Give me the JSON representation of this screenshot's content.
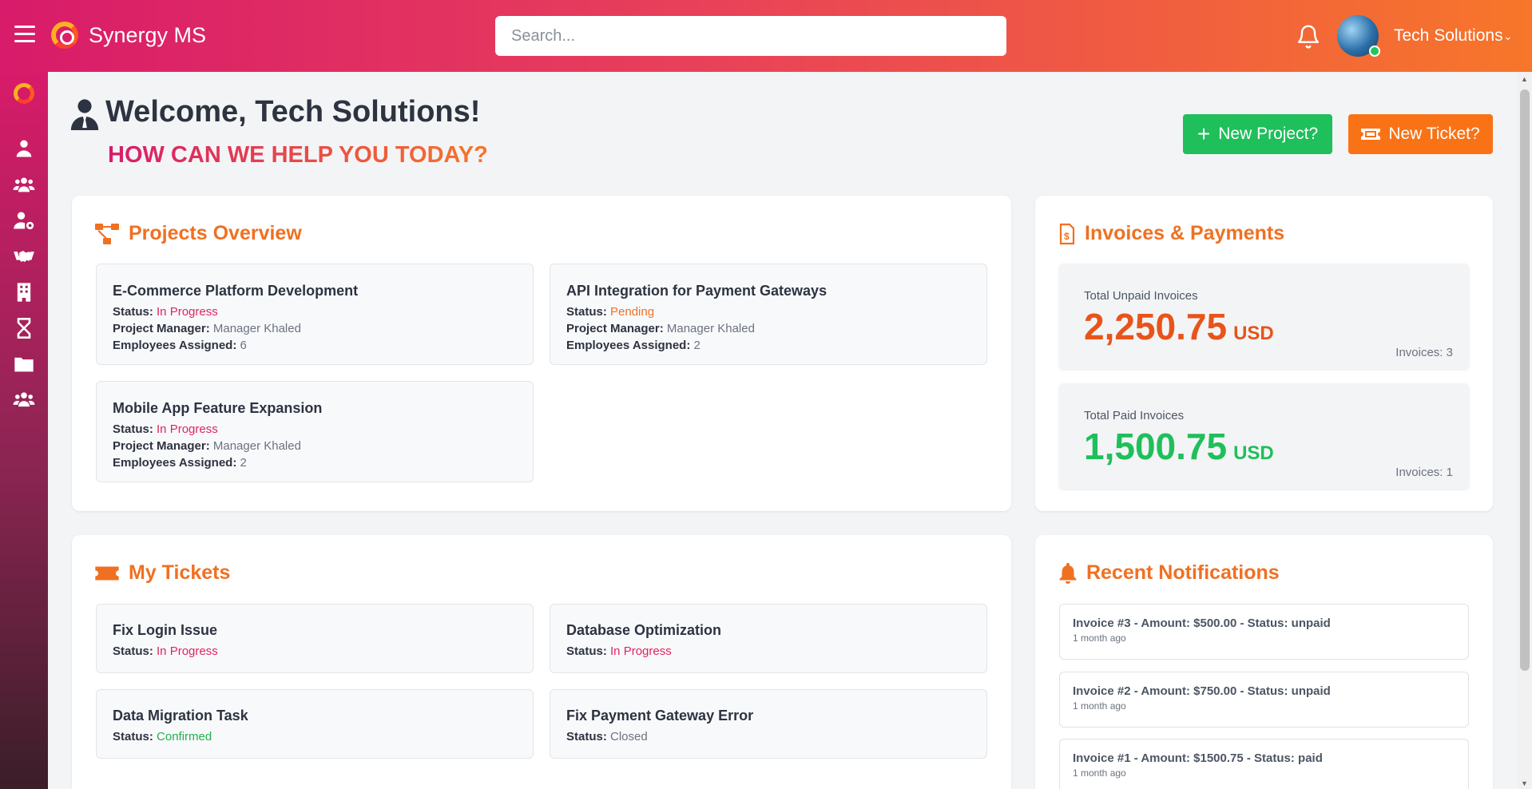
{
  "header": {
    "brand": "Synergy MS",
    "search_placeholder": "Search...",
    "user_name": "Tech Solutions"
  },
  "welcome": {
    "title": "Welcome, Tech Solutions!",
    "subtitle": "HOW CAN WE HELP YOU TODAY?"
  },
  "actions": {
    "new_project": "New Project?",
    "new_ticket": "New Ticket?"
  },
  "projects": {
    "title": "Projects Overview",
    "status_label": "Status:",
    "manager_label": "Project Manager:",
    "employees_label": "Employees Assigned:",
    "items": [
      {
        "name": "E-Commerce Platform Development",
        "status": "In Progress",
        "manager": "Manager Khaled",
        "employees": "6"
      },
      {
        "name": "API Integration for Payment Gateways",
        "status": "Pending",
        "manager": "Manager Khaled",
        "employees": "2"
      },
      {
        "name": "Mobile App Feature Expansion",
        "status": "In Progress",
        "manager": "Manager Khaled",
        "employees": "2"
      }
    ]
  },
  "invoices": {
    "title": "Invoices & Payments",
    "unpaid": {
      "label": "Total Unpaid Invoices",
      "amount": "2,250.75",
      "currency": "USD",
      "count": "Invoices: 3",
      "color": "#e8541a"
    },
    "paid": {
      "label": "Total Paid Invoices",
      "amount": "1,500.75",
      "currency": "USD",
      "count": "Invoices: 1",
      "color": "#1fbf5b"
    }
  },
  "tickets": {
    "title": "My Tickets",
    "status_label": "Status:",
    "items": [
      {
        "name": "Fix Login Issue",
        "status": "In Progress"
      },
      {
        "name": "Database Optimization",
        "status": "In Progress"
      },
      {
        "name": "Data Migration Task",
        "status": "Confirmed"
      },
      {
        "name": "Fix Payment Gateway Error",
        "status": "Closed"
      }
    ]
  },
  "notifications": {
    "title": "Recent Notifications",
    "items": [
      {
        "text": "Invoice #3 - Amount: $500.00 - Status: unpaid",
        "time": "1 month ago"
      },
      {
        "text": "Invoice #2 - Amount: $750.00 - Status: unpaid",
        "time": "1 month ago"
      },
      {
        "text": "Invoice #1 - Amount: $1500.75 - Status: paid",
        "time": "1 month ago"
      }
    ]
  },
  "sidebar": {
    "icons": [
      "logo-icon",
      "user-icon",
      "users-icon",
      "user-settings-icon",
      "handshake-icon",
      "building-icon",
      "hourglass-icon",
      "folder-icon",
      "team-icon"
    ]
  },
  "colors": {
    "accent_orange": "#f07021",
    "header_start": "#d81b6a",
    "header_end": "#f7762a",
    "green": "#1fbf5b"
  }
}
